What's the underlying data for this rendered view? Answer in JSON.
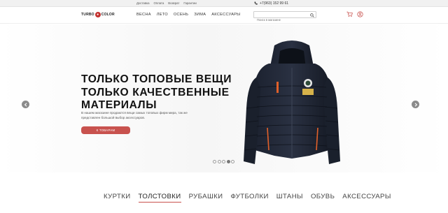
{
  "topbar": {
    "links": [
      "Доставка",
      "Оплата",
      "Возврат",
      "Гарантии"
    ],
    "phone": "+7(963) 152 99 61"
  },
  "header": {
    "logo": {
      "part1": "TURBO",
      "part2": "COLOR"
    },
    "nav": [
      "ВЕСНА",
      "ЛЕТО",
      "ОСЕНЬ",
      "ЗИМА",
      "АКСЕССУАРЫ"
    ],
    "search": {
      "placeholder": "Поиск в магазине",
      "icon": "search-icon"
    },
    "icons": [
      "cart-icon",
      "user-icon"
    ]
  },
  "hero": {
    "title_lines": [
      "ТОЛЬКО ТОПОВЫЕ ВЕЩИ",
      "ТОЛЬКО КАЧЕСТВЕННЫЕ",
      "МАТЕРИАЛЫ"
    ],
    "description": "В нашем магазине продаются вещи самых топовых фирм мира, так же представлен большой выбор аксессуаров.",
    "cta_label": "К ТОВАРАМ",
    "slides": 5,
    "active_slide": 4,
    "accent": "#c8524e"
  },
  "categories": {
    "items": [
      "КУРТКИ",
      "ТОЛСТОВКИ",
      "РУБАШКИ",
      "ФУТБОЛКИ",
      "ШТАНЫ",
      "ОБУВЬ",
      "АКСЕССУАРЫ"
    ],
    "active": "ТОЛСТОВКИ"
  }
}
